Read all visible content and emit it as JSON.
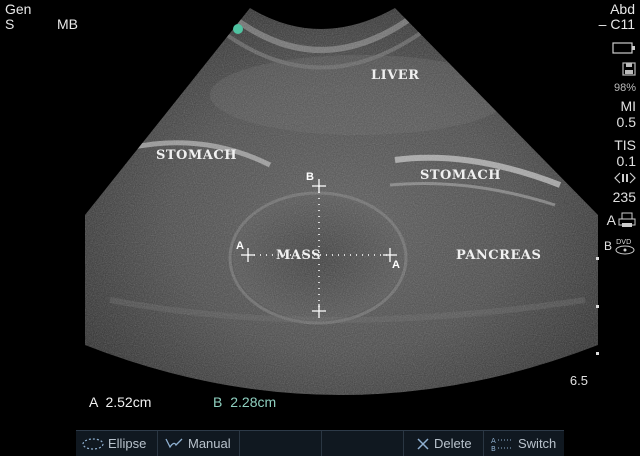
{
  "top_left": {
    "line1": "Gen",
    "line2": "S",
    "mode": "MB"
  },
  "top_right": {
    "preset": "Abd",
    "probe": "– C11"
  },
  "right_panel": {
    "storage_percent": "98%",
    "mi_label": "MI",
    "mi_value": "0.5",
    "tis_label": "TIS",
    "tis_value": "0.1",
    "depth_value": "235",
    "a_label": "A",
    "b_label": "B",
    "scale_value": "6.5"
  },
  "anatomy": {
    "liver": "LIVER",
    "stomach_left": "STOMACH",
    "stomach_right": "STOMACH",
    "mass": "MASS",
    "pancreas": "PANCREAS"
  },
  "calipers": {
    "a_letter": "A",
    "b_letter": "B"
  },
  "measurements": {
    "a_label": "A",
    "a_value": "2.52cm",
    "b_label": "B",
    "b_value": "2.28cm"
  },
  "toolbar": {
    "ellipse": "Ellipse",
    "manual": "Manual",
    "delete": "Delete",
    "switch": "Switch"
  },
  "colors": {
    "accent": "#4fc3a1",
    "measure_b": "#8fd0c0"
  }
}
